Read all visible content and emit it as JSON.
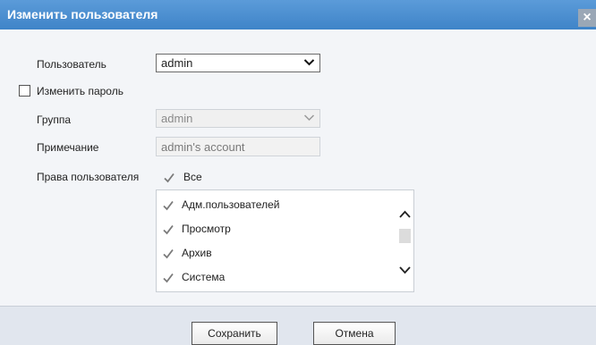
{
  "dialog": {
    "title": "Изменить пользователя",
    "close_glyph": "×"
  },
  "form": {
    "user_label": "Пользователь",
    "user_value": "admin",
    "change_password_label": "Изменить пароль",
    "change_password_checked": false,
    "group_label": "Группа",
    "group_value": "admin",
    "group_disabled": true,
    "note_label": "Примечание",
    "note_value": "admin's account",
    "rights_label": "Права пользователя",
    "all_label": "Все",
    "all_checked": true
  },
  "rights": [
    {
      "label": "Адм.пользователей",
      "checked": true
    },
    {
      "label": "Просмотр",
      "checked": true
    },
    {
      "label": "Архив",
      "checked": true
    },
    {
      "label": "Система",
      "checked": true
    }
  ],
  "buttons": {
    "save": "Сохранить",
    "cancel": "Отмена"
  },
  "icons": {
    "dropdown": "chevron-down-icon",
    "check": "checkmark-icon",
    "scroll_up": "chevron-up-icon",
    "scroll_down": "chevron-down-icon",
    "close": "close-icon"
  },
  "colors": {
    "title_bar": "#4a8fd1",
    "footer": "#e1e6ee",
    "check": "#7a7a7a"
  }
}
